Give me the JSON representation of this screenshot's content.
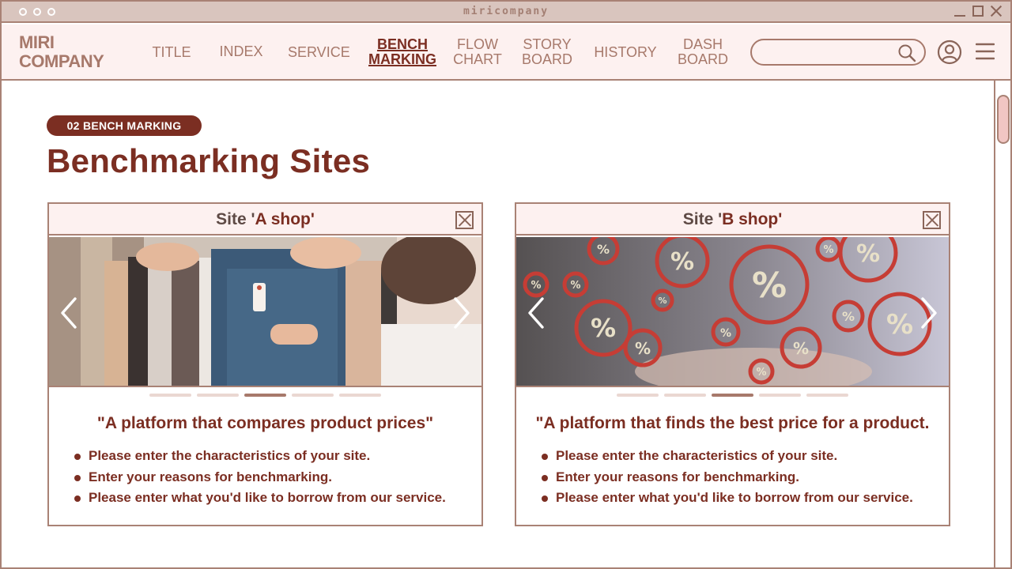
{
  "window": {
    "title": "miricompany",
    "controls": [
      "minimize-icon",
      "maximize-icon",
      "close-icon"
    ]
  },
  "nav": {
    "logo_line1": "MIRI",
    "logo_line2": "COMPANY",
    "items": [
      {
        "line1": "TITLE",
        "line2": ""
      },
      {
        "line1": "INDEX",
        "line2": ""
      },
      {
        "line1": "SERVICE",
        "line2": ""
      },
      {
        "line1": "BENCH",
        "line2": "MARKING",
        "active": true
      },
      {
        "line1": "FLOW",
        "line2": "CHART"
      },
      {
        "line1": "STORY",
        "line2": "BOARD"
      },
      {
        "line1": "HISTORY",
        "line2": ""
      },
      {
        "line1": "DASH",
        "line2": "BOARD"
      }
    ],
    "search": {
      "value": "",
      "placeholder": "",
      "icon": "search-icon"
    },
    "user_icon": "user-icon",
    "menu_icon": "menu-icon"
  },
  "page": {
    "badge": "02 BENCH MARKING",
    "title": "Benchmarking Sites"
  },
  "cards": [
    {
      "title_prefix": "Site '",
      "shop": "A shop",
      "title_suffix": "'",
      "image": "clothing-rack-photo",
      "slides": 5,
      "active_slide": 3,
      "quote": "\"A platform that compares product prices\"",
      "bullets": [
        "Please enter the characteristics of your site.",
        "Enter your reasons for benchmarking.",
        "Please enter what you'd like to borrow from our service."
      ]
    },
    {
      "title_prefix": "Site '",
      "shop": "B shop",
      "title_suffix": "'",
      "image": "percent-bubbles-photo",
      "slides": 5,
      "active_slide": 3,
      "quote": "\"A platform that finds the best price for a product.",
      "bullets": [
        "Please enter the characteristics of your site.",
        "Enter your reasons for benchmarking.",
        "Please enter what you'd like to borrow from our service."
      ]
    }
  ],
  "colors": {
    "primary": "#7b2e22",
    "muted": "#a7796b",
    "border": "#a98275",
    "tint": "#fdf1f0",
    "titlebar": "#d9c5be"
  }
}
